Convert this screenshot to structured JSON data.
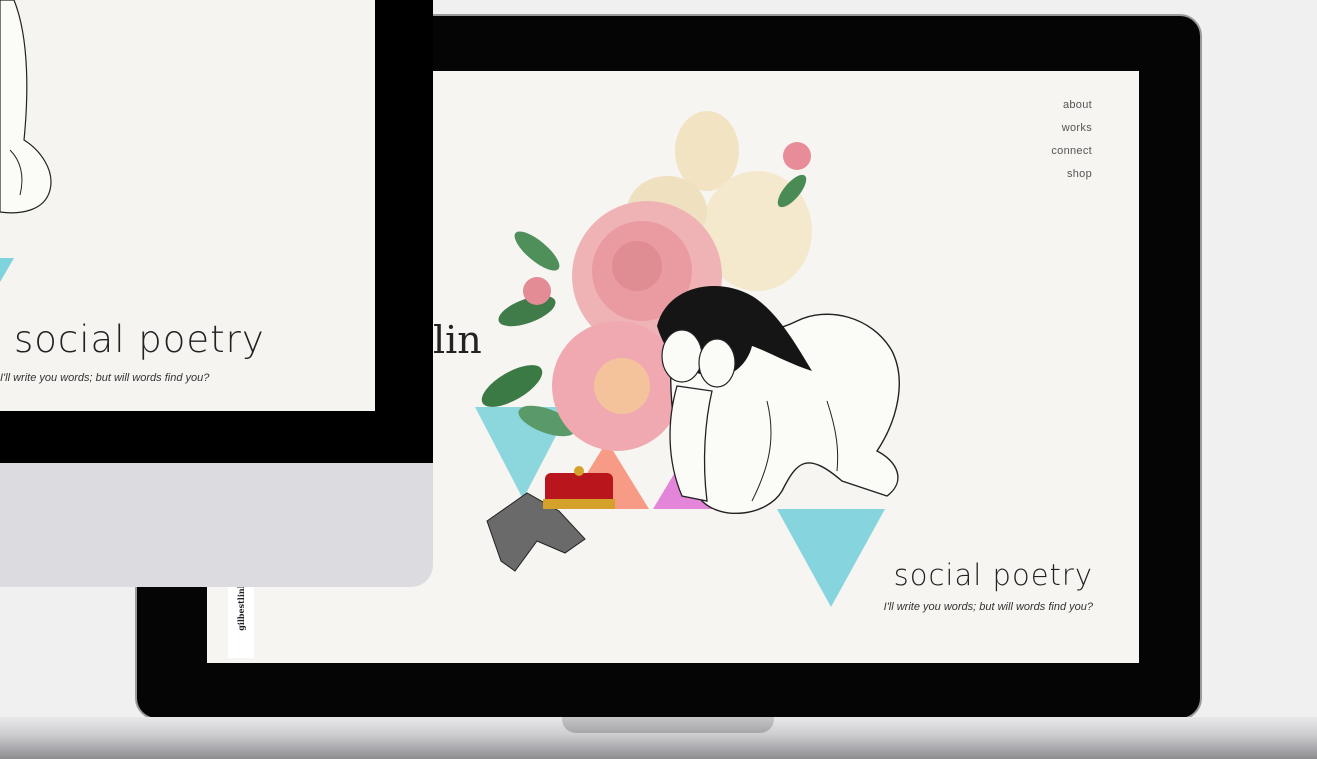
{
  "laptop_site": {
    "nav": [
      "about",
      "works",
      "connect",
      "shop"
    ],
    "title": "social poetry",
    "tagline": "I'll write you words; but will words find you?",
    "side_label": "gilbestlinhir"
  },
  "monitor_site": {
    "title": "social poetry",
    "tagline": "I'll write you words; but will words find you?"
  },
  "background_text": "lin",
  "colors": {
    "cyan": "#7fd3dc",
    "coral": "#f6907a",
    "magenta": "#e07ad6",
    "screen_bg": "#f7f5f2"
  }
}
